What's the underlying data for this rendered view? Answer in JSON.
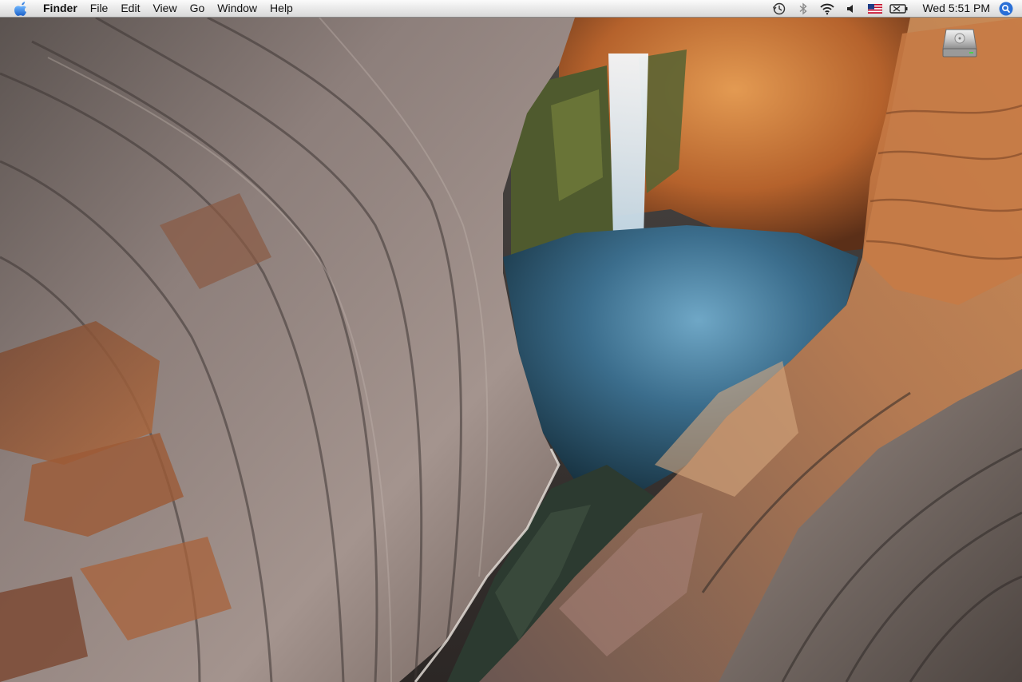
{
  "menubar": {
    "apple_icon": "apple-logo-icon",
    "app_name": "Finder",
    "menus": [
      "File",
      "Edit",
      "View",
      "Go",
      "Window",
      "Help"
    ],
    "status_icons": [
      "time-machine-icon",
      "bluetooth-icon",
      "wifi-icon",
      "volume-icon",
      "us-flag-input-icon",
      "battery-icon"
    ],
    "clock": "Wed 5:51 PM",
    "spotlight_icon": "spotlight-search-icon"
  },
  "desktop": {
    "wallpaper": "canyon-waterfall-pool",
    "icons": [
      {
        "name": "hard-drive-icon",
        "label": ""
      }
    ]
  },
  "colors": {
    "menubar_top": "#fbfbfb",
    "menubar_bottom": "#d9d9d9",
    "spotlight_blue": "#2a6fd6",
    "pool_blue": "#3b6d8c",
    "rock_orange": "#c8743a"
  }
}
